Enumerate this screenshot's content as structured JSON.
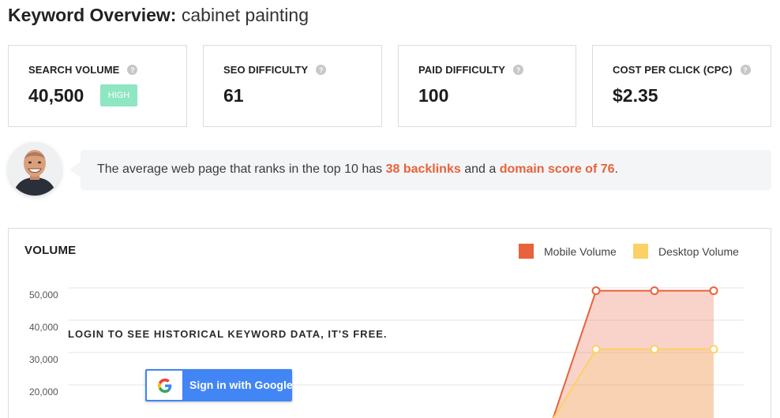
{
  "header": {
    "title_lead": "Keyword Overview:",
    "keyword": "cabinet painting"
  },
  "metrics": [
    {
      "label": "SEARCH VOLUME",
      "value": "40,500",
      "badge": "HIGH"
    },
    {
      "label": "SEO DIFFICULTY",
      "value": "61"
    },
    {
      "label": "PAID DIFFICULTY",
      "value": "100"
    },
    {
      "label": "COST PER CLICK (CPC)",
      "value": "$2.35"
    }
  ],
  "insight": {
    "text_1": "The average web page that ranks in the top 10 has ",
    "backlinks": "38 backlinks",
    "text_2": " and a ",
    "domain_score": "domain score of 76",
    "text_3": "."
  },
  "volume_panel": {
    "title": "VOLUME",
    "legend": [
      {
        "name": "Mobile Volume",
        "color": "#e8623c"
      },
      {
        "name": "Desktop Volume",
        "color": "#fbd166"
      }
    ],
    "login_message": "LOGIN TO SEE HISTORICAL KEYWORD DATA, IT'S FREE.",
    "google_button_label": "Sign in with Google"
  },
  "chart_data": {
    "type": "area",
    "y_ticks": [
      "50,000",
      "40,000",
      "30,000",
      "20,000"
    ],
    "ylim": [
      0,
      50000
    ],
    "grid": true,
    "legend_position": "top-right",
    "series": [
      {
        "name": "Mobile Volume",
        "color": "#e8623c",
        "values": [
          0,
          49500,
          49500,
          49500
        ]
      },
      {
        "name": "Desktop Volume",
        "color": "#fbd166",
        "values": [
          0,
          27000,
          27000,
          27000
        ]
      }
    ]
  },
  "colors": {
    "accent": "#e8623c",
    "badge_high": "#8ee6c3",
    "google_blue": "#4285f4"
  },
  "icons": {
    "help": "question-circle-icon",
    "avatar": "user-avatar",
    "google": "google-g-icon"
  }
}
